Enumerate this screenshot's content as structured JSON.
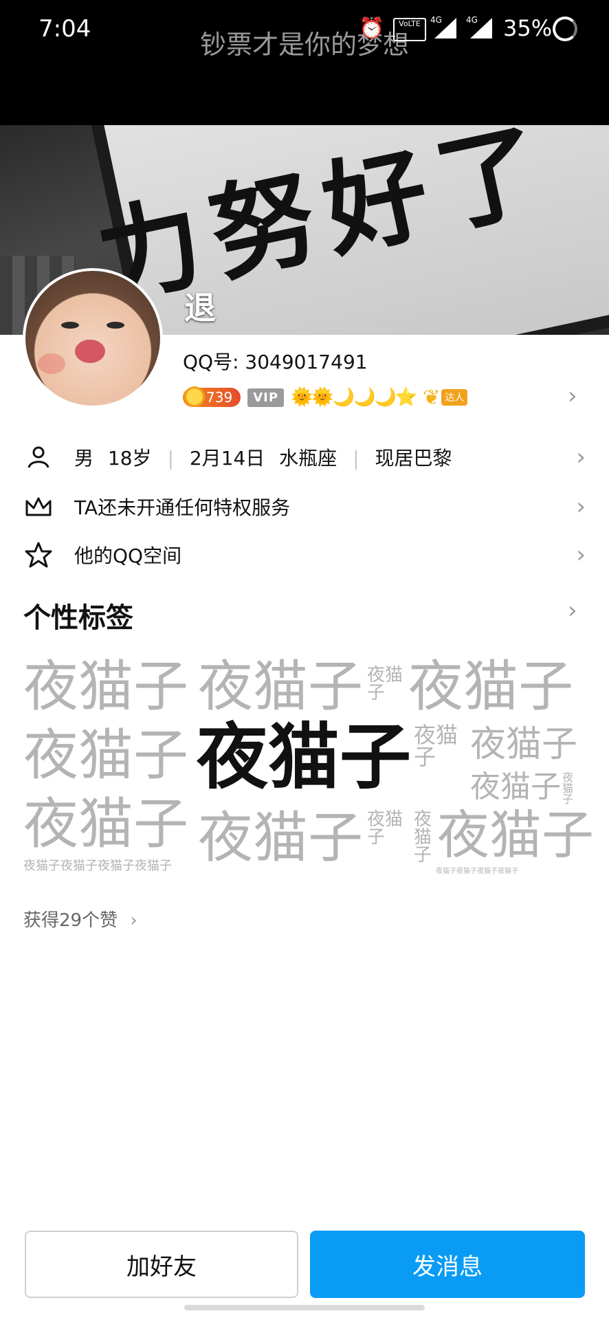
{
  "status_bar": {
    "time": "7:04",
    "signature": "钞票才是你的梦想",
    "battery": "35%",
    "icons": [
      "alarm-icon",
      "volte-icon",
      "signal-4g-icon",
      "signal-4g-icon",
      "battery-icon"
    ],
    "network_labels": [
      "4G",
      "4G"
    ]
  },
  "profile": {
    "cover_text": "力努好了",
    "nickname": "退",
    "qq_label": "QQ号:",
    "qq_number": "3049017491",
    "coin_level": "739",
    "vip_label": "VIP",
    "level_icons": "🌞🌞🌙🌙🌙⭐",
    "daren_label": "达人"
  },
  "info": {
    "gender": "男",
    "age": "18岁",
    "birthday": "2月14日",
    "zodiac": "水瓶座",
    "location": "现居巴黎",
    "privilege": "TA还未开通任何特权服务",
    "qzone": "他的QQ空间"
  },
  "tags": {
    "title": "个性标签",
    "word": "夜猫子",
    "word_single": [
      "夜",
      "猫",
      "子"
    ],
    "tiny_line": "夜猫子夜猫子夜猫子夜猫子"
  },
  "likes": {
    "text": "获得29个赞",
    "chevron": "›"
  },
  "buttons": {
    "add_friend": "加好友",
    "send_message": "发消息"
  },
  "colors": {
    "accent": "#0a9cf5",
    "tag_gray": "#b4b4b4"
  }
}
